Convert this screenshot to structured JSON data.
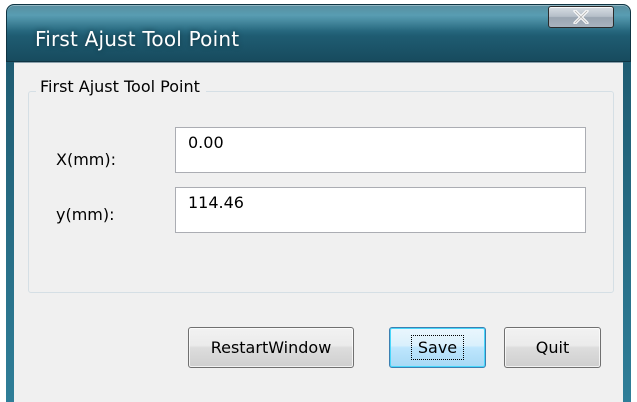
{
  "window": {
    "title": "First Ajust Tool Point",
    "close_label": "X"
  },
  "group": {
    "legend": "First Ajust Tool Point"
  },
  "fields": {
    "x_label": "X(mm):",
    "x_value": "0.00",
    "y_label": "y(mm):",
    "y_value": "114.46"
  },
  "buttons": {
    "restart_label": "RestartWindow",
    "save_label": "Save",
    "quit_label": "Quit"
  },
  "colors": {
    "titlebar": "#1f5c72",
    "client_bg": "#f0f0f0",
    "default_button_border": "#3c7fb1"
  }
}
